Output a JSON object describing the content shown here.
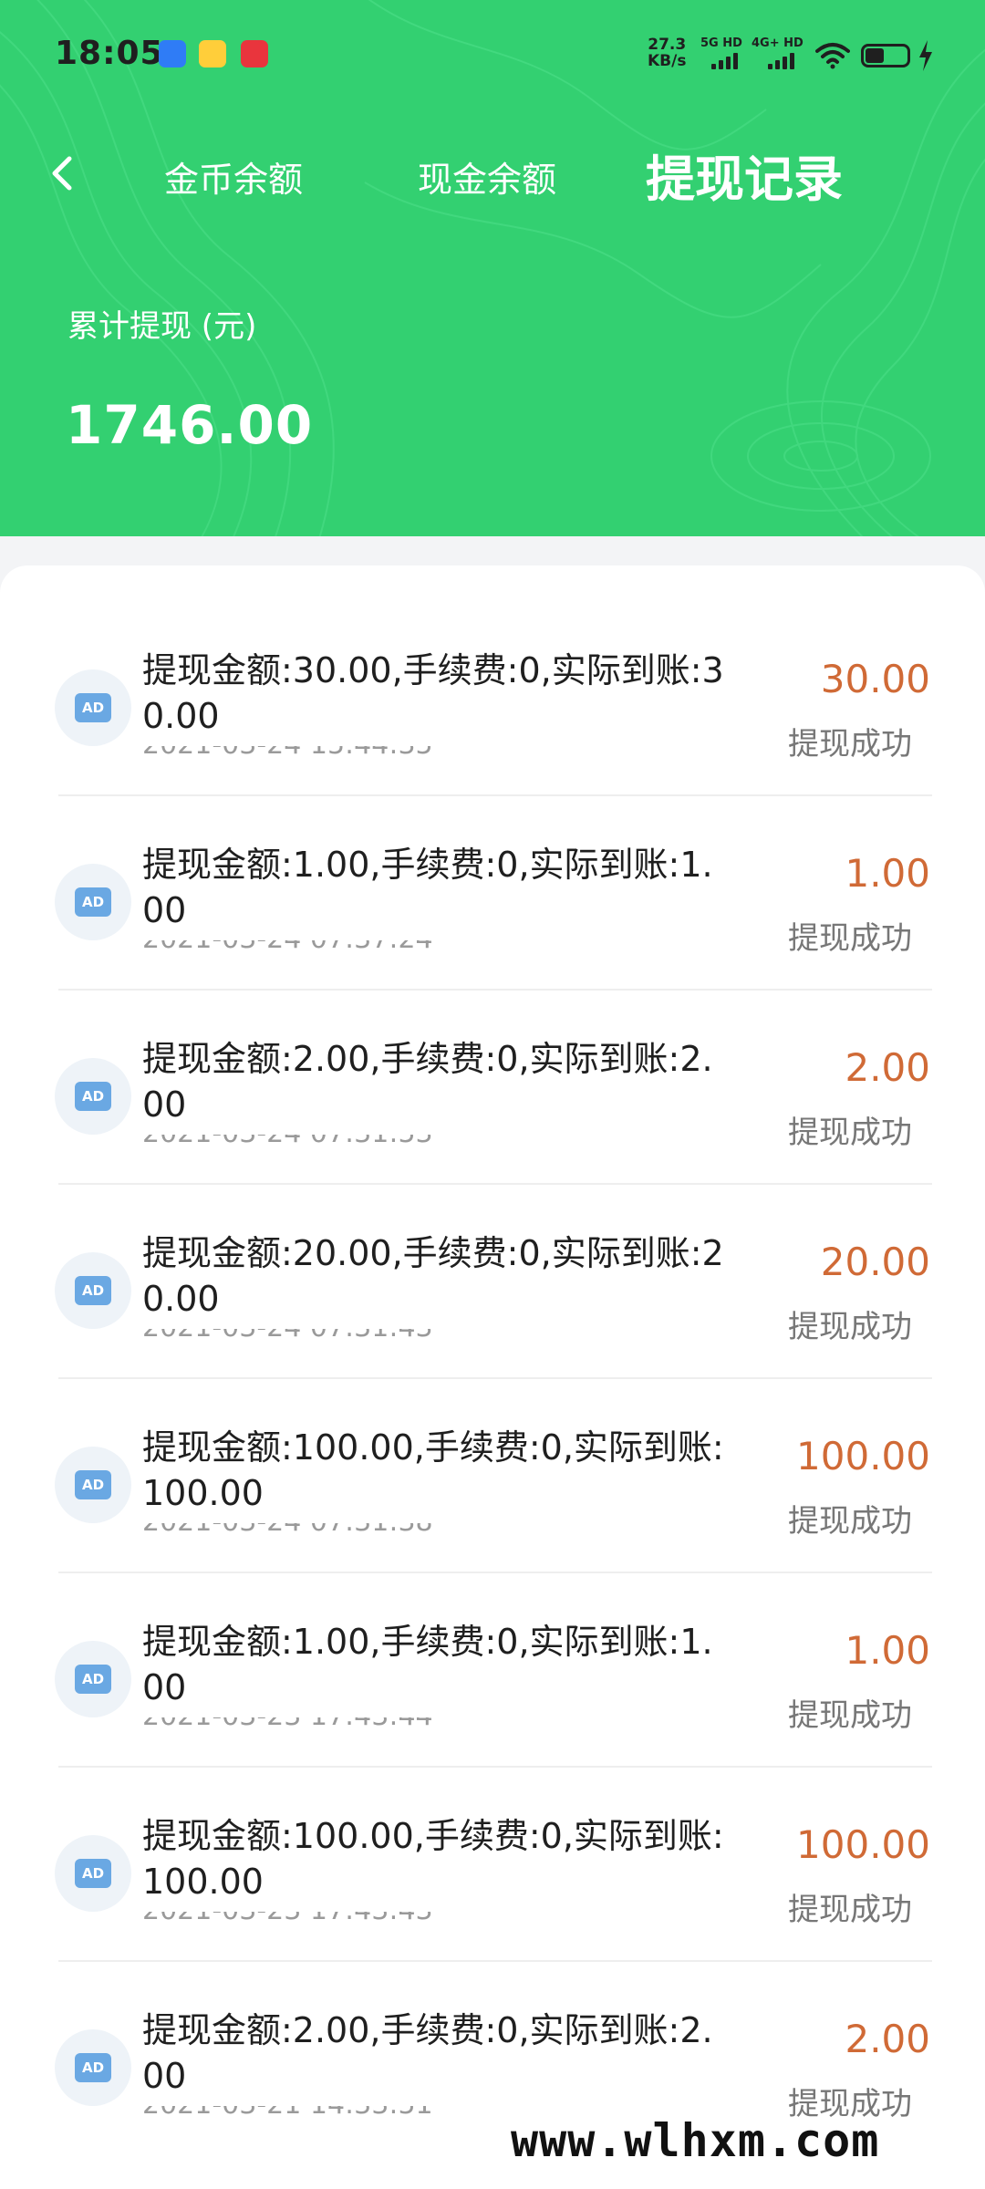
{
  "status_bar": {
    "time": "18:05",
    "net_speed_value": "27.3",
    "net_speed_unit": "KB/s",
    "signal1_label": "5G HD",
    "signal2_label": "4G+ HD"
  },
  "nav": {
    "tabs": [
      {
        "label": "金币余额",
        "active": false
      },
      {
        "label": "现金余额",
        "active": false
      },
      {
        "label": "提现记录",
        "active": true
      }
    ]
  },
  "summary": {
    "label": "累计提现 (元)",
    "value": "1746.00"
  },
  "records": [
    {
      "desc": "提现金额:30.00,手续费:0,实际到账:30.00",
      "amount": "30.00",
      "status": "提现成功",
      "date": "2021-03-24 15:44:35",
      "icon": "ad-icon"
    },
    {
      "desc": "提现金额:1.00,手续费:0,实际到账:1.00",
      "amount": "1.00",
      "status": "提现成功",
      "date": "2021-03-24 07:37:24",
      "icon": "ad-icon"
    },
    {
      "desc": "提现金额:2.00,手续费:0,实际到账:2.00",
      "amount": "2.00",
      "status": "提现成功",
      "date": "2021-03-24 07:31:53",
      "icon": "ad-icon"
    },
    {
      "desc": "提现金额:20.00,手续费:0,实际到账:20.00",
      "amount": "20.00",
      "status": "提现成功",
      "date": "2021-03-24 07:31:43",
      "icon": "ad-icon"
    },
    {
      "desc": "提现金额:100.00,手续费:0,实际到账:100.00",
      "amount": "100.00",
      "status": "提现成功",
      "date": "2021-03-24 07:31:38",
      "icon": "ad-icon"
    },
    {
      "desc": "提现金额:1.00,手续费:0,实际到账:1.00",
      "amount": "1.00",
      "status": "提现成功",
      "date": "2021-03-23 17:43:44",
      "icon": "ad-icon"
    },
    {
      "desc": "提现金额:100.00,手续费:0,实际到账:100.00",
      "amount": "100.00",
      "status": "提现成功",
      "date": "2021-03-23 17:43:43",
      "icon": "ad-icon"
    },
    {
      "desc": "提现金额:2.00,手续费:0,实际到账:2.00",
      "amount": "2.00",
      "status": "提现成功",
      "date": "2021-03-21 14:33:51",
      "icon": "ad-icon"
    }
  ],
  "watermark": "www.wlhxm.com",
  "colors": {
    "header_green": "#33d071",
    "amount_orange": "#d06a36",
    "status_gray": "#777777"
  }
}
